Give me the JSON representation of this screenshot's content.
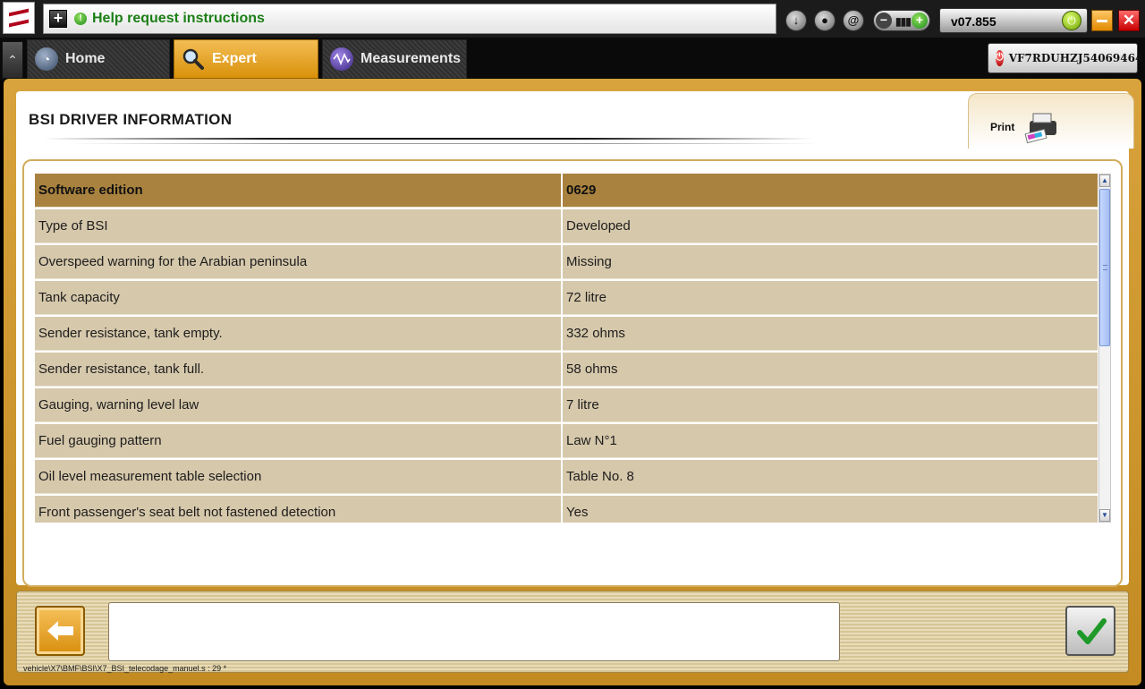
{
  "topbar": {
    "help_text": "Help request instructions",
    "version": "v07.855"
  },
  "tabs": [
    {
      "label": "Home"
    },
    {
      "label": "Expert"
    },
    {
      "label": "Measurements"
    }
  ],
  "vin": "VF7RDUHZJ54069464",
  "page": {
    "title": "BSI  DRIVER INFORMATION",
    "print_label": "Print"
  },
  "table": {
    "header": {
      "label": "Software edition",
      "value": "0629"
    },
    "rows": [
      {
        "label": "Type of BSI",
        "value": "Developed"
      },
      {
        "label": "Overspeed warning for the Arabian peninsula",
        "value": "Missing"
      },
      {
        "label": "Tank capacity",
        "value": "72 litre"
      },
      {
        "label": "Sender resistance, tank empty.",
        "value": "332 ohms"
      },
      {
        "label": "Sender resistance, tank full.",
        "value": "58 ohms"
      },
      {
        "label": "Gauging, warning level law",
        "value": "7 litre"
      },
      {
        "label": "Fuel gauging pattern",
        "value": "Law N°1"
      },
      {
        "label": "Oil level measurement table selection",
        "value": "Table No. 8"
      },
      {
        "label": "Front passenger's seat belt not fastened detection",
        "value": "Yes"
      }
    ]
  },
  "status": {
    "file_path": "vehicle\\X7\\BMF\\BSI\\X7_BSI_telecodage_manuel.s : 29 *"
  },
  "colors": {
    "accent": "#d9910a",
    "header_row": "#a9823f",
    "row_bg": "#d6c8ab",
    "help_text": "#1c7f16"
  },
  "icons": {
    "logo": "citroen-logo",
    "help": "add-icon",
    "back": "arrow-left-icon",
    "confirm": "checkmark-icon",
    "print": "printer-icon"
  }
}
